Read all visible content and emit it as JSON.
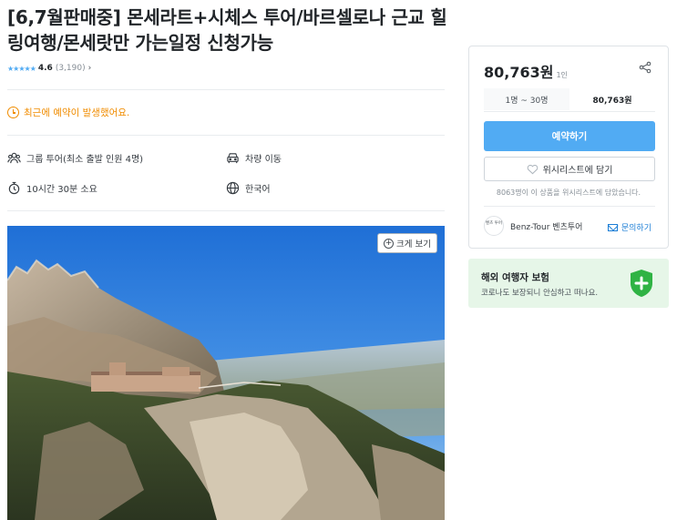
{
  "product": {
    "title": "[6,7월판매중] 몬세라트+시체스 투어/바르셀로나 근교 힐링여행/몬세랏만 가는일정 신청가능",
    "stars": "★★★★★",
    "rating": "4.6",
    "review_count": "(3,190)",
    "review_chevron": "›",
    "recent_booking_notice": "최근에 예약이 발생했어요."
  },
  "info_items": {
    "tour_type": "그룹 투어(최소 출발 인원 4명)",
    "transport": "차량 이동",
    "duration": "10시간 30분 소요",
    "language": "한국어"
  },
  "photo": {
    "zoom_label": "크게 보기",
    "zoom_icon": "+"
  },
  "booking_card": {
    "price": "80,763원",
    "price_unit": "1인",
    "people_range": "1명 ~ 30명",
    "range_price": "80,763원",
    "book_button": "예약하기",
    "wishlist_button": "위시리스트에 담기",
    "wishlist_count_text": "8063명이 이 상품을 위시리스트에 담았습니다.",
    "seller_logo_text": "벤츠 투어",
    "seller_name": "Benz-Tour 벤츠투어",
    "inquiry_button": "문의하기"
  },
  "insurance": {
    "title": "해외 여행자 보험",
    "description": "코로나도 보장되니 안심하고 떠나요."
  },
  "colors": {
    "accent": "#51abf3",
    "notice": "#f08c00",
    "insurance_bg": "#e6f6e8",
    "shield": "#2fb344",
    "link": "#1c7ed6"
  },
  "icons": [
    "group-icon",
    "car-icon",
    "clock-icon",
    "globe-icon",
    "share-icon",
    "heart-icon",
    "mail-icon",
    "shield-plus-icon",
    "zoom-plus-icon",
    "alert-clock-icon"
  ]
}
